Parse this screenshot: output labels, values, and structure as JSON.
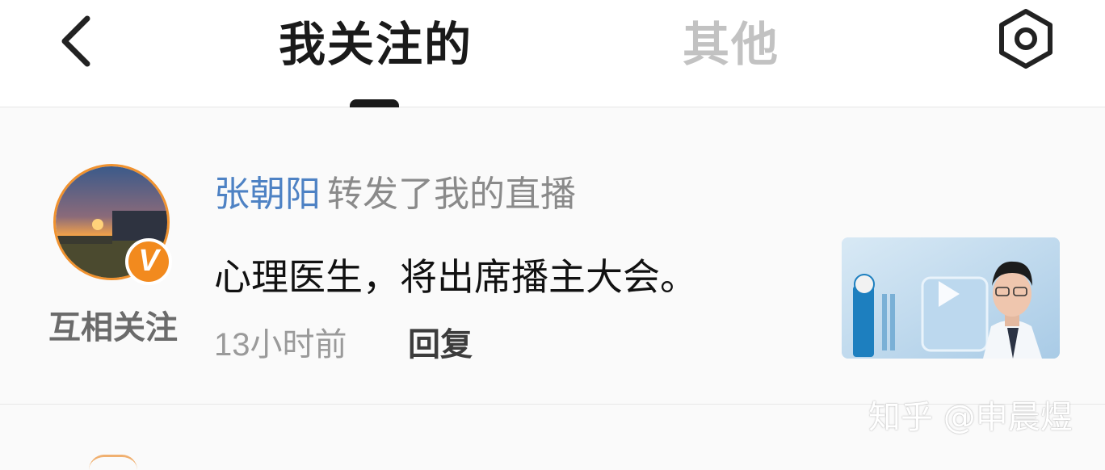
{
  "header": {
    "tabs": [
      {
        "label": "我关注的",
        "active": true
      },
      {
        "label": "其他",
        "active": false
      }
    ],
    "icons": {
      "back": "chevron-left-icon",
      "settings": "hexagon-settings-icon"
    }
  },
  "notification": {
    "user_name": "张朝阳",
    "action": "转发了我的直播",
    "message": "心理医生，将出席播主大会。",
    "timestamp": "13小时前",
    "reply_label": "回复",
    "relationship": "互相关注",
    "verified_badge": "V",
    "thumbnail_icon": "play-icon"
  },
  "watermark": "知乎 @申晨煜",
  "colors": {
    "accent_blue": "#4e82c4",
    "badge_orange": "#f28a1e",
    "text_primary": "#111111",
    "text_secondary": "#8a8a8a",
    "tab_inactive": "#c2c2c2"
  }
}
